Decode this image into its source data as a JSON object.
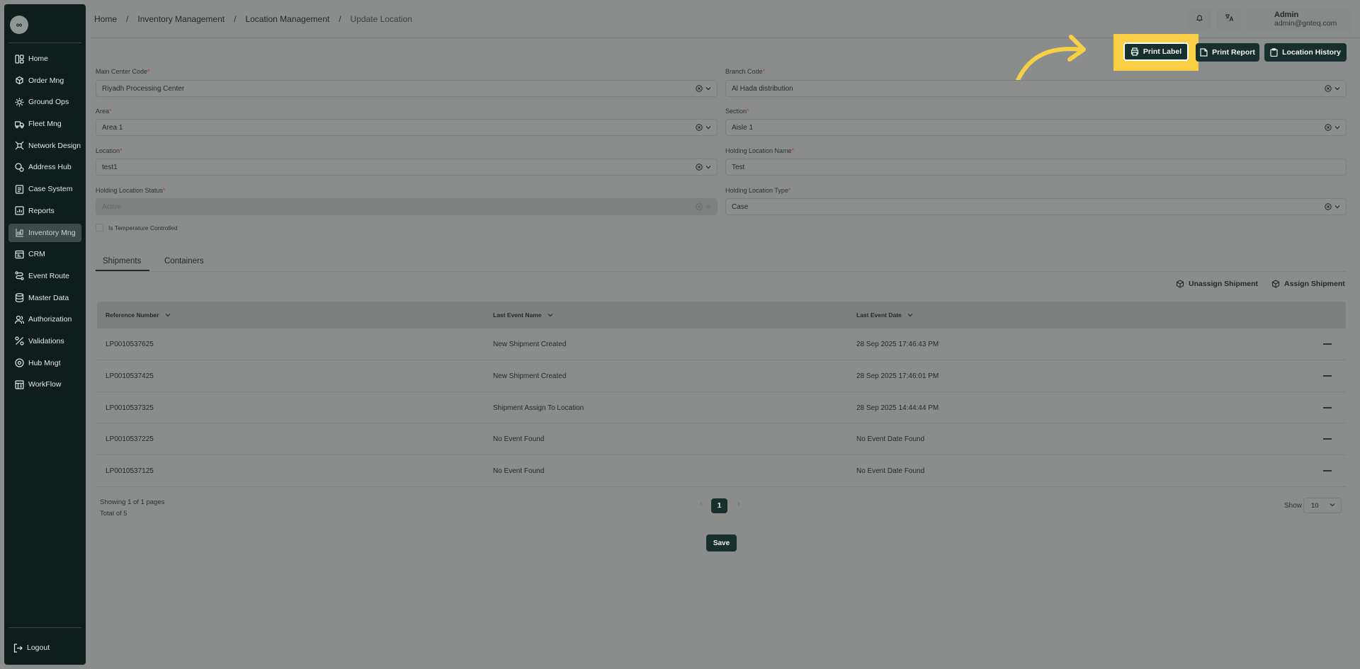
{
  "app": {
    "logo_text": "∞"
  },
  "sidebar": {
    "items": [
      {
        "label": "Home",
        "icon": "layout-icon"
      },
      {
        "label": "Order Mng",
        "icon": "box-icon"
      },
      {
        "label": "Ground Ops",
        "icon": "sun-icon"
      },
      {
        "label": "Fleet Mng",
        "icon": "truck-icon"
      },
      {
        "label": "Network Design",
        "icon": "network-icon"
      },
      {
        "label": "Address Hub",
        "icon": "map-pin-icon"
      },
      {
        "label": "Case System",
        "icon": "briefcase-icon"
      },
      {
        "label": "Reports",
        "icon": "chart-icon"
      },
      {
        "label": "Inventory Mng",
        "icon": "inventory-icon",
        "active": true
      },
      {
        "label": "CRM",
        "icon": "crm-icon"
      },
      {
        "label": "Event Route",
        "icon": "route-icon"
      },
      {
        "label": "Master Data",
        "icon": "database-icon"
      },
      {
        "label": "Authorization",
        "icon": "users-icon"
      },
      {
        "label": "Validations",
        "icon": "percent-icon"
      },
      {
        "label": "Hub Mngt",
        "icon": "hub-icon"
      },
      {
        "label": "WorkFlow",
        "icon": "workflow-icon"
      }
    ],
    "logout_label": "Logout"
  },
  "breadcrumb": {
    "home": "Home",
    "inventory": "Inventory Management",
    "location": "Location Management",
    "current": "Update Location",
    "separator": "/"
  },
  "user": {
    "name": "Admin",
    "email": "admin@gnteq.com"
  },
  "actions": {
    "print_label": "Print Label",
    "print_report": "Print Report",
    "location_history": "Location History"
  },
  "form": {
    "main_center_code": {
      "label": "Main Center Code",
      "required": "*",
      "value": "Riyadh Processing Center"
    },
    "branch_code": {
      "label": "Branch Code",
      "required": "*",
      "value": "Al Hada distribution"
    },
    "area": {
      "label": "Area",
      "required": "*",
      "value": "Area 1"
    },
    "section": {
      "label": "Section",
      "required": "*",
      "value": "Aisle 1"
    },
    "location": {
      "label": "Location",
      "required": "*",
      "value": "test1"
    },
    "holding_location_name": {
      "label": "Holding Location Name",
      "required": "*",
      "value": "Test"
    },
    "holding_location_status": {
      "label": "Holding Location Status",
      "required": "*",
      "value": "Active"
    },
    "holding_location_type": {
      "label": "Holding Location Type",
      "required": "*",
      "value": "Case"
    },
    "temperature_controlled": {
      "label": "Is Temperature Controlled",
      "checked": false
    }
  },
  "tabs": {
    "shipments": "Shipments",
    "containers": "Containers"
  },
  "shipment_actions": {
    "unassign": "Unassign Shipment",
    "assign": "Assign Shipment"
  },
  "table": {
    "headers": [
      "Reference Number",
      "Last Event Name",
      "Last Event Date"
    ],
    "rows": [
      [
        "LP0010537625",
        "New Shipment Created",
        "28 Sep 2025 17:46:43 PM"
      ],
      [
        "LP0010537425",
        "New Shipment Created",
        "28 Sep 2025 17:46:01 PM"
      ],
      [
        "LP0010537325",
        "Shipment Assign To Location",
        "28 Sep 2025 14:44:44 PM"
      ],
      [
        "LP0010537225",
        "No Event Found",
        "No Event Date Found"
      ],
      [
        "LP0010537125",
        "No Event Found",
        "No Event Date Found"
      ]
    ]
  },
  "pagination": {
    "showing": "Showing 1 of 1 pages",
    "total": "Total of 5",
    "current_page": "1",
    "prev": "‹",
    "next": "›",
    "show_label": "Show",
    "page_size": "10"
  },
  "save_label": "Save",
  "colors": {
    "primary": "#17302e",
    "highlight": "#f7d046",
    "sidebar": "#0f1d1c"
  }
}
